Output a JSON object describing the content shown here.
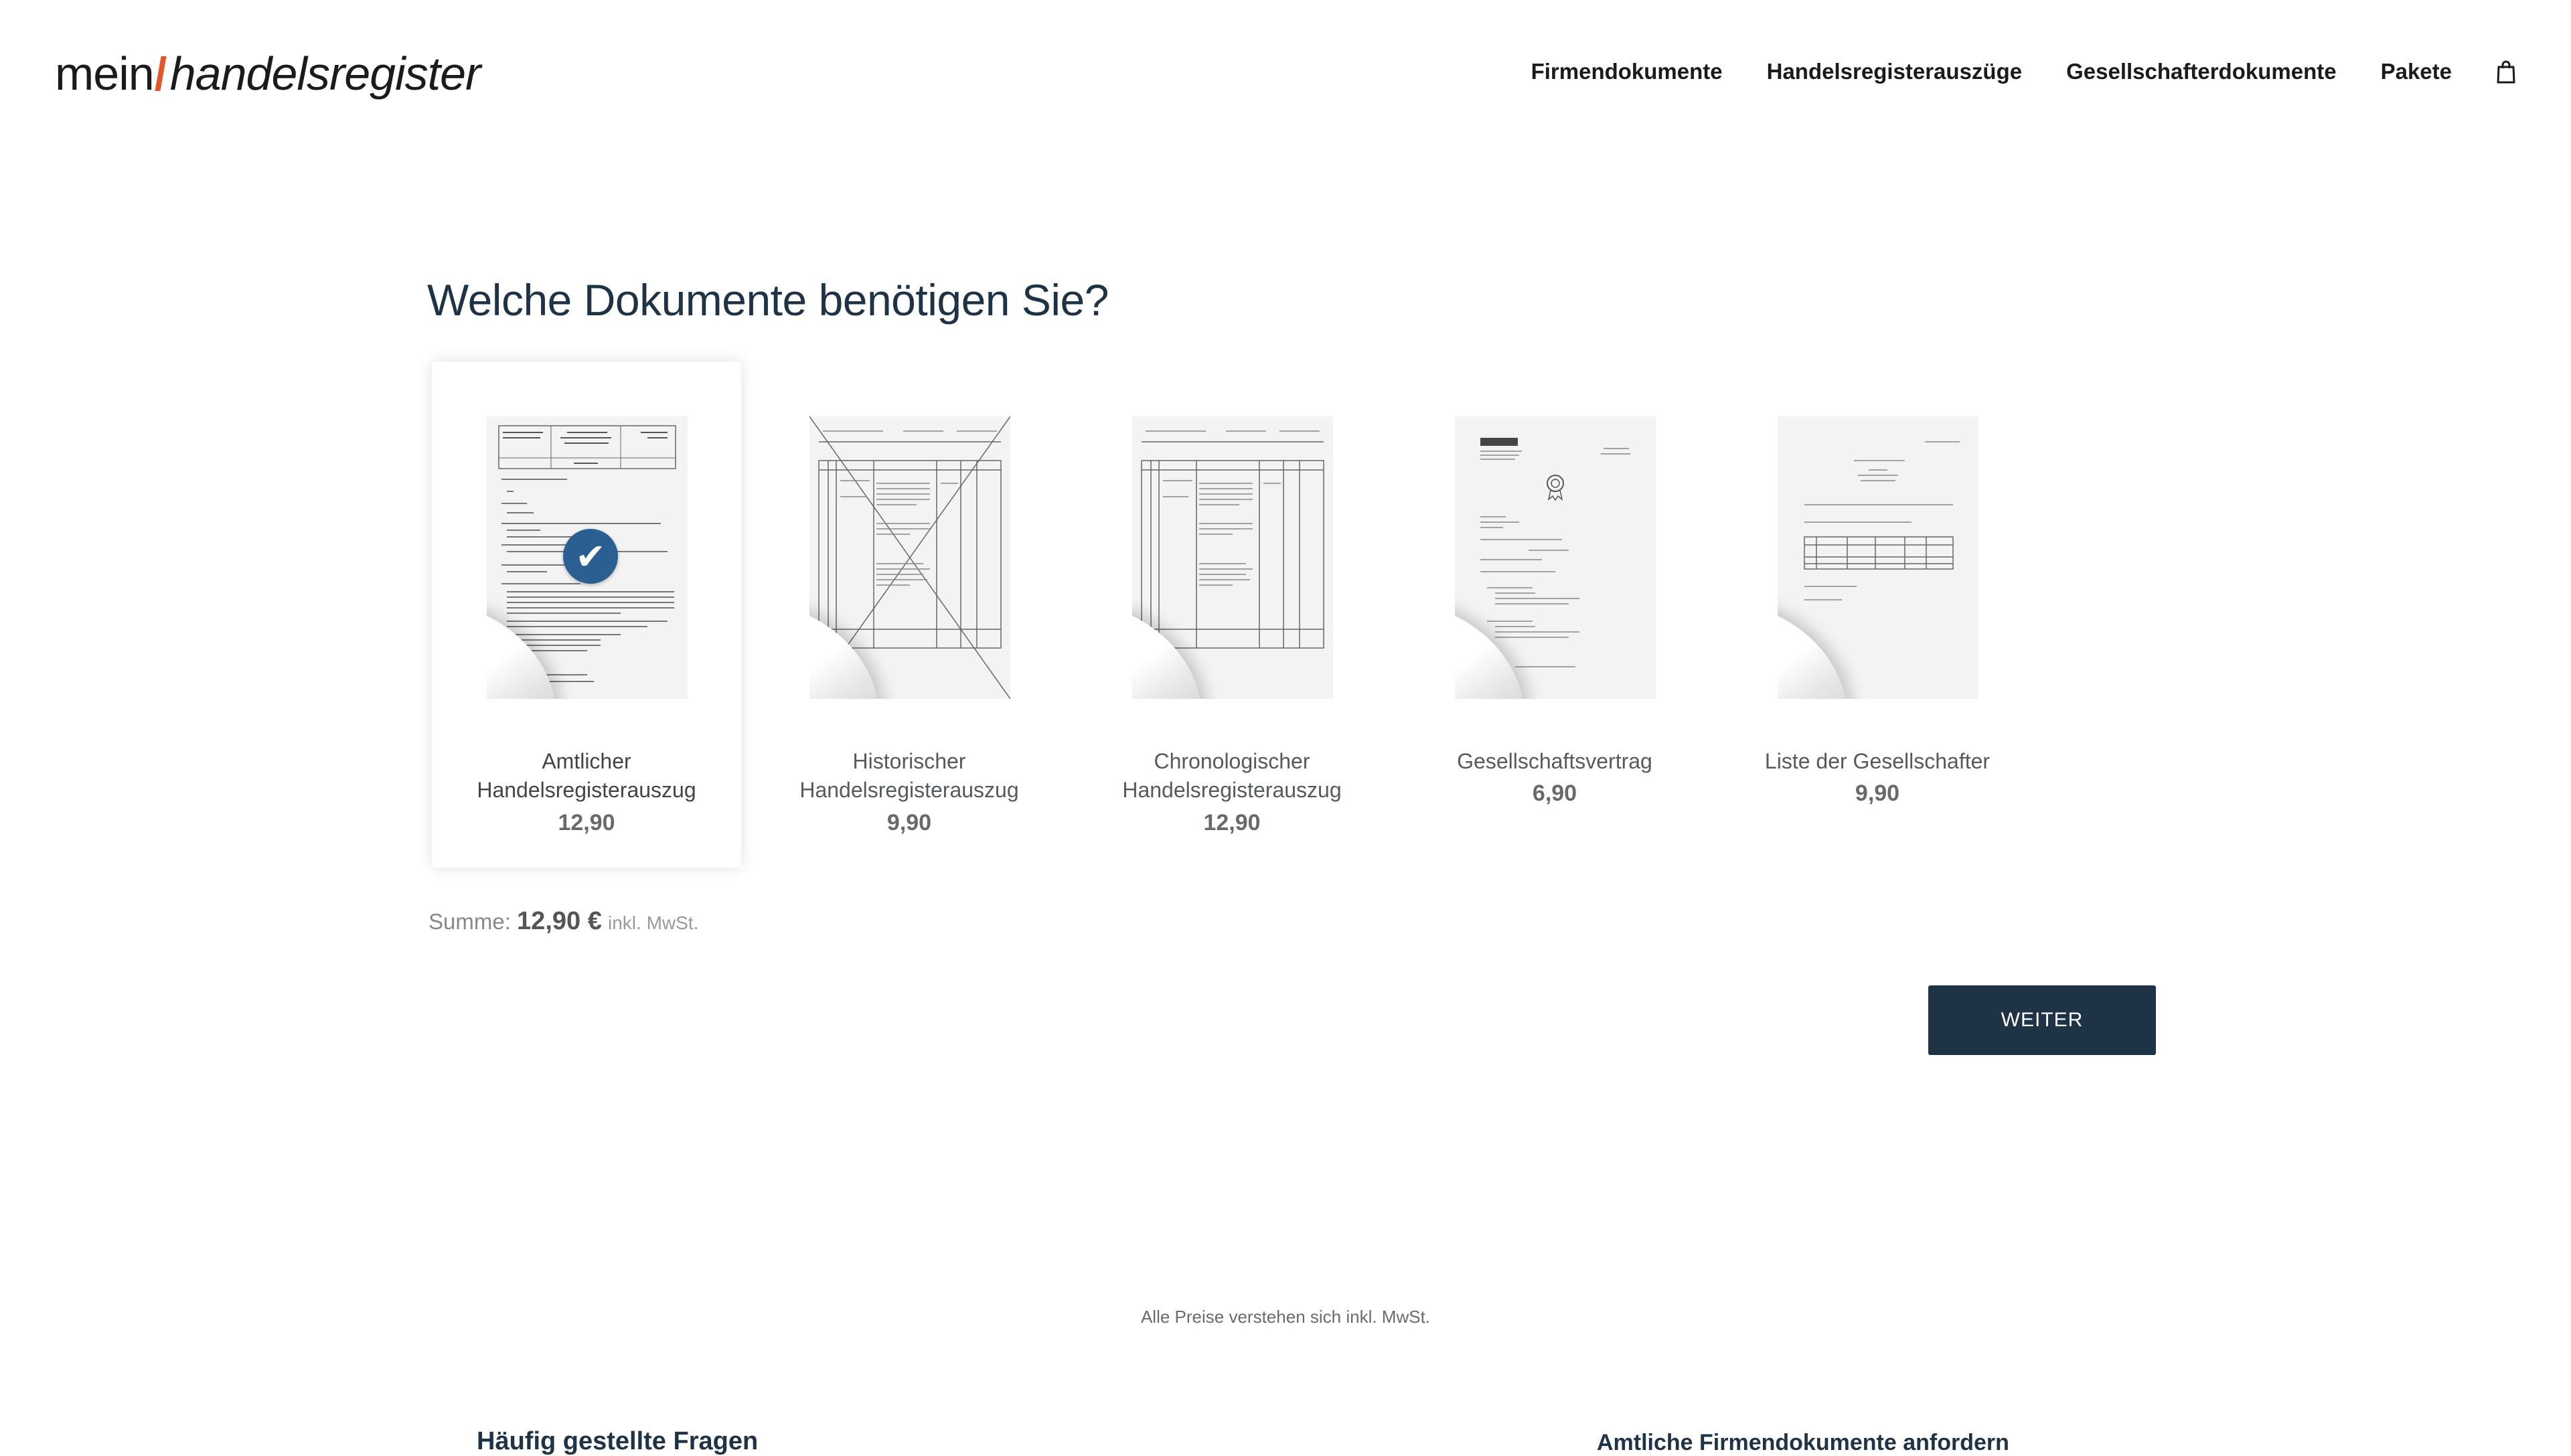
{
  "header": {
    "logo_mein": "mein",
    "logo_brand": "handelsregister",
    "nav": [
      {
        "label": "Firmendokumente"
      },
      {
        "label": "Handelsregisterauszüge"
      },
      {
        "label": "Gesellschafterdokumente"
      },
      {
        "label": "Pakete"
      }
    ],
    "cart_icon": "shopping-bag-icon"
  },
  "main": {
    "title": "Welche Dokumente benötigen Sie?",
    "documents": [
      {
        "name_line1": "Amtlicher",
        "name_line2": "Handelsregisterauszug",
        "price": "12,90",
        "selected": true
      },
      {
        "name_line1": "Historischer",
        "name_line2": "Handelsregisterauszug",
        "price": "9,90",
        "selected": false
      },
      {
        "name_line1": "Chronologischer",
        "name_line2": "Handelsregisterauszug",
        "price": "12,90",
        "selected": false
      },
      {
        "name_line1": "Gesellschaftsvertrag",
        "name_line2": "",
        "price": "6,90",
        "selected": false
      },
      {
        "name_line1": "Liste der Gesellschafter",
        "name_line2": "",
        "price": "9,90",
        "selected": false
      }
    ],
    "sum_label": "Summe:",
    "sum_amount": "12,90 €",
    "sum_tax": "inkl. MwSt.",
    "continue_button": "WEITER",
    "price_note": "Alle Preise verstehen sich inkl. MwSt."
  },
  "footer_sections": {
    "faq_heading": "Häufig gestellte Fragen",
    "request_heading": "Amtliche Firmendokumente anfordern"
  },
  "colors": {
    "accent": "#1f3346",
    "check": "#2c5f91",
    "logo_bar": "#e0572a"
  }
}
